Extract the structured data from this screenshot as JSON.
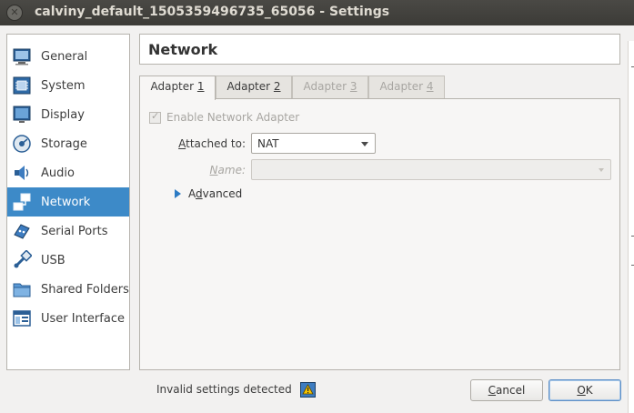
{
  "window": {
    "title": "calviny_default_1505359496735_65056 - Settings",
    "close_glyph": "✕"
  },
  "sidebar": {
    "items": [
      {
        "label": "General",
        "icon": "general-icon",
        "selected": false
      },
      {
        "label": "System",
        "icon": "system-icon",
        "selected": false
      },
      {
        "label": "Display",
        "icon": "display-icon",
        "selected": false
      },
      {
        "label": "Storage",
        "icon": "storage-icon",
        "selected": false
      },
      {
        "label": "Audio",
        "icon": "audio-icon",
        "selected": false
      },
      {
        "label": "Network",
        "icon": "network-icon",
        "selected": true
      },
      {
        "label": "Serial Ports",
        "icon": "serial-ports-icon",
        "selected": false
      },
      {
        "label": "USB",
        "icon": "usb-icon",
        "selected": false
      },
      {
        "label": "Shared Folders",
        "icon": "shared-folders-icon",
        "selected": false
      },
      {
        "label": "User Interface",
        "icon": "user-interface-icon",
        "selected": false
      }
    ]
  },
  "page": {
    "title": "Network"
  },
  "tabs": [
    {
      "label_pre": "Adapter ",
      "label_key": "1",
      "state": "active"
    },
    {
      "label_pre": "Adapter ",
      "label_key": "2",
      "state": "normal"
    },
    {
      "label_pre": "Adapter ",
      "label_key": "3",
      "state": "disabled"
    },
    {
      "label_pre": "Adapter ",
      "label_key": "4",
      "state": "disabled"
    }
  ],
  "adapter": {
    "enable_label": "Enable Network Adapter",
    "enabled_checked": true,
    "attached_label_pre": "",
    "attached_label_key": "A",
    "attached_label_post": "ttached to:",
    "attached_value": "NAT",
    "name_label_key": "N",
    "name_label_post": "ame:",
    "name_value": "",
    "advanced_label_key": "d",
    "advanced_label_pre": "A",
    "advanced_label_post": "vanced"
  },
  "status": {
    "text": "Invalid settings detected",
    "icon": "warning-icon"
  },
  "buttons": {
    "cancel_key": "C",
    "cancel_post": "ancel",
    "ok_key": "O",
    "ok_post": "K"
  },
  "colors": {
    "selection": "#3d8ac8",
    "titlebar": "#3c3b37",
    "accent_arrow": "#2c7bc4"
  }
}
